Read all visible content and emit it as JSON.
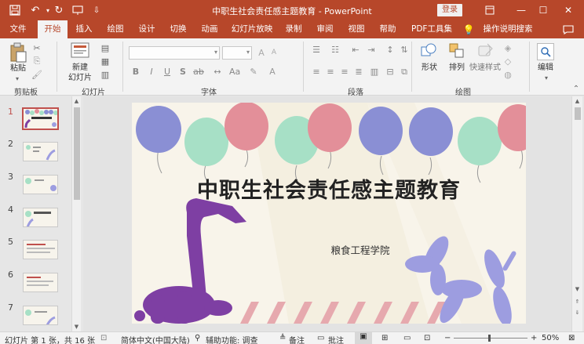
{
  "titlebar": {
    "title": "中职生社会责任感主题教育 - PowerPoint",
    "login": "登录",
    "icons": [
      "save-icon",
      "undo-icon",
      "redo-icon",
      "present-icon",
      "customize-icon"
    ]
  },
  "tabs": [
    "文件",
    "开始",
    "插入",
    "绘图",
    "设计",
    "切换",
    "动画",
    "幻灯片放映",
    "录制",
    "审阅",
    "视图",
    "帮助",
    "PDF工具集",
    "操作说明搜索"
  ],
  "active_tab": "开始",
  "ribbon": {
    "paste": "粘贴",
    "new_slide_line1": "新建",
    "new_slide_line2": "幻灯片",
    "shape": "形状",
    "arrange": "排列",
    "quick_styles": "快速样式",
    "edit": "编辑",
    "groups": {
      "clipboard": "剪贴板",
      "slides": "幻灯片",
      "font": "字体",
      "paragraph": "段落",
      "drawing": "绘图"
    }
  },
  "thumbnails": {
    "numbers": [
      "1",
      "2",
      "3",
      "4",
      "5",
      "6",
      "7"
    ],
    "active": "1"
  },
  "slide": {
    "title": "中职生社会责任感主题教育",
    "subtitle": "粮食工程学院"
  },
  "statusbar": {
    "slide_info": "幻灯片 第 1 张，共 16 张",
    "language": "简体中文(中国大陆)",
    "accessibility": "辅助功能: 调查",
    "notes": "备注",
    "comments": "批注",
    "zoom": "50%"
  },
  "colors": {
    "accent": "#b7472a",
    "balloon_blue": "#8a8fd4",
    "balloon_mint": "#a7e0c6",
    "balloon_pink": "#e38f99",
    "giraffe": "#7e3fa3",
    "dog": "#9d9de0",
    "stripe": "#e6a9ae"
  }
}
